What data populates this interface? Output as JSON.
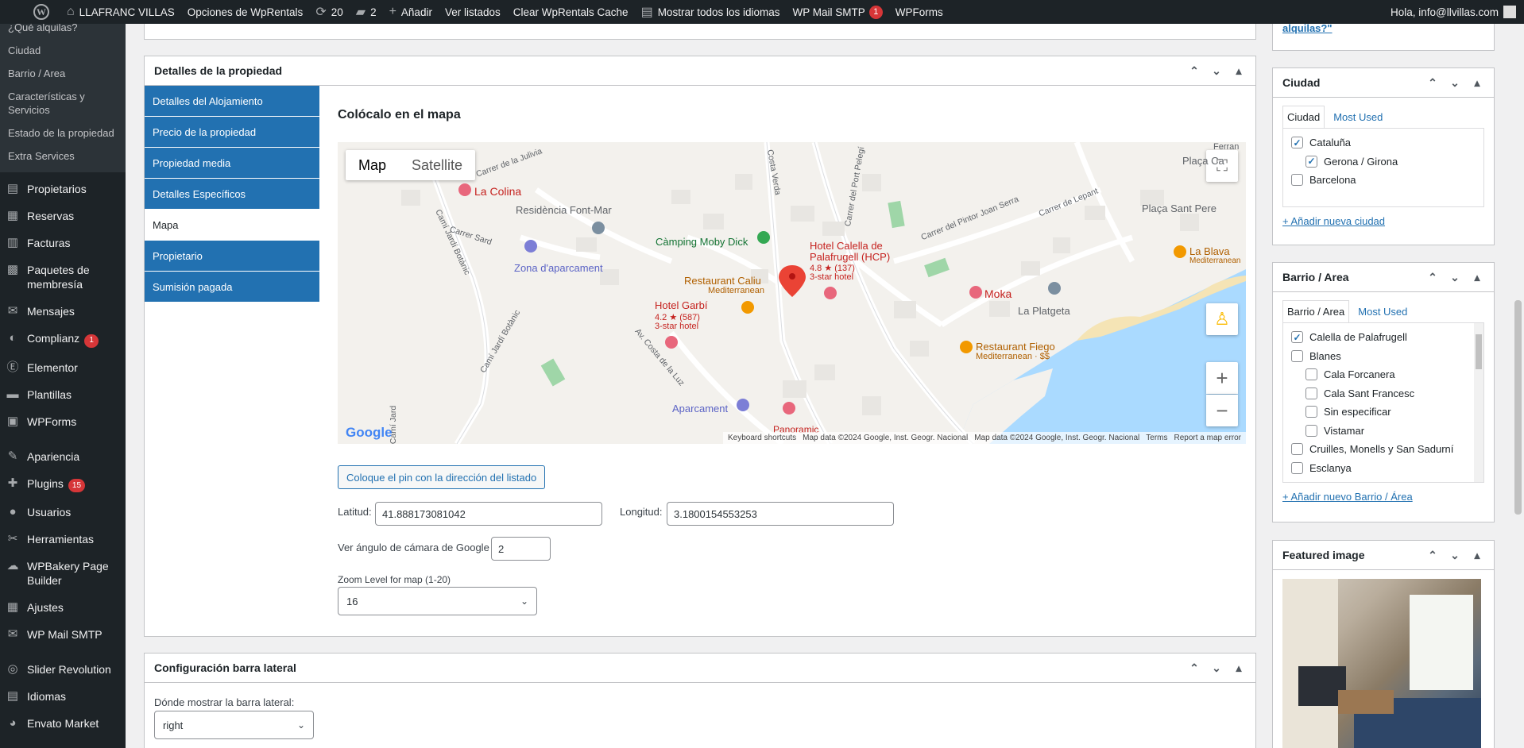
{
  "admin_bar": {
    "site_name": "LLAFRANC VILLAS",
    "wprentals_options": "Opciones de WpRentals",
    "updates_count": "20",
    "comments_count": "2",
    "add_new": "Añadir",
    "view_listings": "Ver listados",
    "clear_cache": "Clear WpRentals Cache",
    "show_languages": "Mostrar todos los idiomas",
    "wp_mail_smtp": "WP Mail SMTP",
    "wp_mail_smtp_badge": "1",
    "wpforms": "WPForms",
    "greeting": "Hola, info@llvillas.com"
  },
  "sidebar": {
    "submenu": [
      "¿Qué alquilas?",
      "Ciudad",
      "Barrio / Area",
      "Características y Servicios",
      "Estado de la propiedad",
      "Extra Services"
    ],
    "items": [
      {
        "label": "Propietarios",
        "icon": "users-icon",
        "glyph": "▤"
      },
      {
        "label": "Reservas",
        "icon": "calendar-icon",
        "glyph": "▦"
      },
      {
        "label": "Facturas",
        "icon": "invoice-icon",
        "glyph": "▥"
      },
      {
        "label": "Paquetes de membresía",
        "icon": "package-icon",
        "glyph": "▩"
      },
      {
        "label": "Mensajes",
        "icon": "email-icon",
        "glyph": "✉"
      },
      {
        "label": "Complianz",
        "icon": "complianz-icon",
        "glyph": "◐",
        "badge": "1"
      },
      {
        "label": "Elementor",
        "icon": "elementor-icon",
        "glyph": "Ⓔ"
      },
      {
        "label": "Plantillas",
        "icon": "folder-icon",
        "glyph": "▬"
      },
      {
        "label": "WPForms",
        "icon": "forms-icon",
        "glyph": "▣"
      },
      {
        "label": "Apariencia",
        "icon": "paintbrush-icon",
        "glyph": "✎"
      },
      {
        "label": "Plugins",
        "icon": "plugin-icon",
        "glyph": "✚",
        "badge": "15"
      },
      {
        "label": "Usuarios",
        "icon": "user-icon",
        "glyph": "●"
      },
      {
        "label": "Herramientas",
        "icon": "wrench-icon",
        "glyph": "✂"
      },
      {
        "label": "WPBakery Page Builder",
        "icon": "wpbakery-icon",
        "glyph": "☁"
      },
      {
        "label": "Ajustes",
        "icon": "settings-icon",
        "glyph": "▦"
      },
      {
        "label": "WP Mail SMTP",
        "icon": "mail-icon",
        "glyph": "✉"
      },
      {
        "label": "Slider Revolution",
        "icon": "slider-icon",
        "glyph": "◎"
      },
      {
        "label": "Idiomas",
        "icon": "language-icon",
        "glyph": "▤"
      },
      {
        "label": "Envato Market",
        "icon": "envato-icon",
        "glyph": "◕"
      }
    ]
  },
  "top_box": {
    "link_text": "alquilas?\""
  },
  "property_details": {
    "title": "Detalles de la propiedad",
    "tabs": [
      "Detalles del Alojamiento",
      "Precio de la propiedad",
      "Propiedad media",
      "Detalles Específicos",
      "Mapa",
      "Propietario",
      "Sumisión pagada"
    ],
    "active_tab": "Mapa",
    "section_title": "Colócalo en el mapa",
    "map": {
      "map_button": "Map",
      "satellite_button": "Satellite",
      "places": {
        "la_colina": "La Colina",
        "residencia": "Residència Font-Mar",
        "zona_aparcament": "Zona d'aparcament",
        "camping": "Càmping Moby Dick",
        "hotel_calella": "Hotel Calella de",
        "hotel_calella2": "Palafrugell (HCP)",
        "hotel_calella_rating": "4.8 ★ (137)",
        "hotel_calella_type": "3-star hotel",
        "restaurant_caliu": "Restaurant Caliu",
        "restaurant_caliu_sub": "Mediterranean",
        "hotel_garbi": "Hotel Garbí",
        "hotel_garbi_rating": "4.2 ★ (587)",
        "hotel_garbi_type": "3-star hotel",
        "moka": "Moka",
        "la_platgeta": "La Platgeta",
        "restaurant_fiego": "Restaurant Fiego",
        "restaurant_fiego_sub": "Mediterranean · $$",
        "la_blava": "La Blava",
        "la_blava_sub": "Mediterranean",
        "placa_sant_pere": "Plaça Sant Pere",
        "placa_ca": "Plaça Ca",
        "aparcament": "Aparcament",
        "panoramic": "Panoramic",
        "ferran": "Ferran"
      },
      "streets": {
        "julivia": "Carrer de la Julivia",
        "sard": "Carrer Sard",
        "jardi_botanic": "Camí Jardí Botànic",
        "jardi_botanic2": "Camí Jardí Botànic",
        "cami_jardi": "Camí Jard",
        "costa_verda": "Costa Verda",
        "port_pelegi": "Carrer del Port Pelegí",
        "pintor": "Carrer del Pintor Joan Serra",
        "lepant": "Carrer de Lepant",
        "costa_luz": "Av. Costa de la Luz"
      },
      "google_logo": "Google",
      "footer": [
        "Keyboard shortcuts",
        "Map data ©2024 Google, Inst. Geogr. Nacional",
        "Map data ©2024 Google, Inst. Geogr. Nacional",
        "Terms",
        "Report a map error"
      ]
    },
    "pin_button": "Coloque el pin con la dirección del listado",
    "latitude_label": "Latitud:",
    "latitude_value": "41.888173081042",
    "longitude_label": "Longitud:",
    "longitude_value": "3.1800154553253",
    "camera_label": "Ver ángulo de cámara de Google",
    "camera_value": "2",
    "zoom_label": "Zoom Level for map (1-20)",
    "zoom_value": "16"
  },
  "sidebar_config": {
    "title": "Configuración barra lateral",
    "label": "Dónde mostrar la barra lateral:",
    "value": "right"
  },
  "ciudad_box": {
    "title": "Ciudad",
    "tab_all": "Ciudad",
    "tab_most_used": "Most Used",
    "items": [
      {
        "label": "Cataluña",
        "checked": "yes",
        "indent": "0"
      },
      {
        "label": "Gerona / Girona",
        "checked": "yes",
        "indent": "1"
      },
      {
        "label": "Barcelona",
        "checked": "no",
        "indent": "0"
      }
    ],
    "add_link": "+ Añadir nueva ciudad"
  },
  "barrio_box": {
    "title": "Barrio / Area",
    "tab_all": "Barrio / Area",
    "tab_most_used": "Most Used",
    "items": [
      {
        "label": "Calella de Palafrugell",
        "checked": "yes",
        "indent": "0"
      },
      {
        "label": "Blanes",
        "checked": "no",
        "indent": "0"
      },
      {
        "label": "Cala Forcanera",
        "checked": "no",
        "indent": "1"
      },
      {
        "label": "Cala Sant Francesc",
        "checked": "no",
        "indent": "1"
      },
      {
        "label": "Sin especificar",
        "checked": "no",
        "indent": "1"
      },
      {
        "label": "Vistamar",
        "checked": "no",
        "indent": "1"
      },
      {
        "label": "Cruilles, Monells y San Sadurní",
        "checked": "no",
        "indent": "0"
      },
      {
        "label": "Esclanya",
        "checked": "no",
        "indent": "0"
      }
    ],
    "add_link": "+ Añadir nuevo Barrio / Área"
  },
  "featured_image": {
    "title": "Featured image"
  }
}
